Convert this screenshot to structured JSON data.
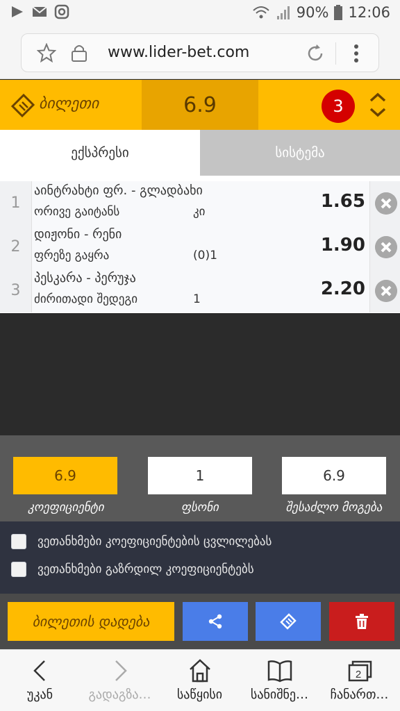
{
  "statusbar": {
    "battery": "90%",
    "time": "12:06"
  },
  "browser": {
    "url": "www.lider-bet.com"
  },
  "ticket": {
    "title": "ბილეთი",
    "total_odds": "6.9",
    "count": "3"
  },
  "tabs": [
    {
      "label": "ექსპრესი"
    },
    {
      "label": "სისტემა"
    }
  ],
  "bets": [
    {
      "num": "1",
      "match": "აინტრახტი ფრ. - გლადბახი",
      "market": "ორივე გაიტანს",
      "pick": "კი",
      "odds": "1.65"
    },
    {
      "num": "2",
      "match": "დიჟონი - რენი",
      "market": "ფრეზე გაყრა",
      "pick": "(0)1",
      "odds": "1.90"
    },
    {
      "num": "3",
      "match": "პესკარა - პერუჯა",
      "market": "ძირითადი შედეგი",
      "pick": "1",
      "odds": "2.20"
    }
  ],
  "summary": {
    "odds_value": "6.9",
    "odds_label": "კოეფიციენტი",
    "stake_value": "1",
    "stake_label": "ფსონი",
    "win_value": "6.9",
    "win_label": "შესაძლო მოგება"
  },
  "agreements": {
    "accept_change": "ვეთანხმები კოეფიციენტების ცვლილებას",
    "accept_increased": "ვეთანხმები გაზრდილ კოეფიციენტებს"
  },
  "actions": {
    "place_bet": "ბილეთის დადება"
  },
  "colors": {
    "accent": "#ffbb00",
    "accent_dark": "#e8a400",
    "share": "#4a7de8",
    "delete": "#c91d1d",
    "badge": "#d40000"
  },
  "bottomnav": [
    {
      "label": "უკან",
      "icon": "back-icon"
    },
    {
      "label": "გადაგზა…",
      "icon": "forward-icon"
    },
    {
      "label": "საწყისი",
      "icon": "home-icon"
    },
    {
      "label": "სანიშნე…",
      "icon": "bookmarks-icon"
    },
    {
      "label": "ჩანართ…",
      "icon": "tabs-icon"
    }
  ]
}
